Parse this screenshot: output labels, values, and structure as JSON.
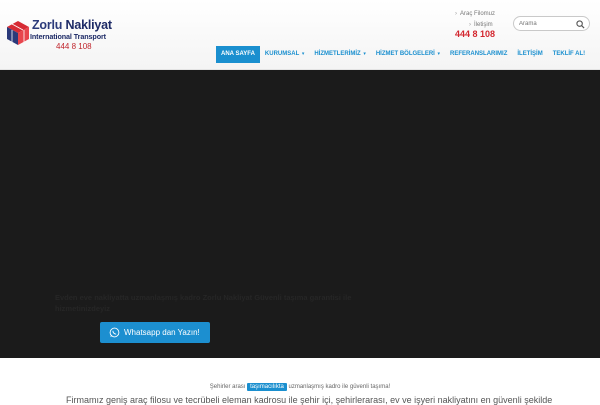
{
  "brand": {
    "name_1": "Zorlu",
    "name_2": "Nakliyat",
    "subtitle": "International Transport",
    "phone": "444 8 108"
  },
  "top_links": [
    {
      "label": "Araç Filomuz"
    },
    {
      "label": "İletişim"
    }
  ],
  "header_phone": "444 8 108",
  "search": {
    "placeholder": "Arama",
    "icon": "search-icon"
  },
  "nav": [
    {
      "label": "ANA SAYFA",
      "caret": ""
    },
    {
      "label": "KURUMSAL",
      "caret": "▾"
    },
    {
      "label": "HİZMETLERİMİZ",
      "caret": "▾"
    },
    {
      "label": "HİZMET BÖLGELERİ",
      "caret": "▾"
    },
    {
      "label": "REFERANSLARIMIZ",
      "caret": ""
    },
    {
      "label": "İLETİŞİM",
      "caret": ""
    },
    {
      "label": "TEKLİF AL!",
      "caret": ""
    }
  ],
  "hero": {
    "text": "Evden eve nakliyatta uzmanlaşmış kadro Zorlu Nakliyat Güvenli taşıma garantisi ile hizmetinizdeyiz",
    "button_label": "Whatsapp dan Yazın!",
    "button_icon": "whatsapp-icon"
  },
  "tagline": {
    "before": "Şehirler arası",
    "highlight": "taşımacılıkta",
    "after": "uzmanlaşmış kadro ile güvenli taşıma!"
  },
  "bottom_text": "Firmamız geniş araç filosu ve tecrübeli eleman kadrosu ile şehir içi, şehirlerarası, ev ve işyeri nakliyatını en güvenli şekilde",
  "colors": {
    "accent": "#1a8fcf",
    "phone_red": "#d3272f",
    "brand_navy": "#1d2a66",
    "hero_bg": "#1b1b1b"
  }
}
